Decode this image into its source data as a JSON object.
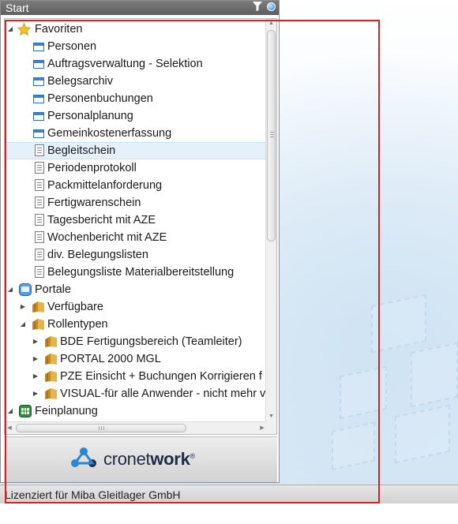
{
  "panel": {
    "title": "Start"
  },
  "tree": {
    "favoriten": {
      "label": "Favoriten",
      "items": [
        {
          "label": "Personen",
          "icon": "window-icon"
        },
        {
          "label": "Auftragsverwaltung - Selektion",
          "icon": "window-icon"
        },
        {
          "label": "Belegsarchiv",
          "icon": "window-icon"
        },
        {
          "label": "Personenbuchungen",
          "icon": "window-icon"
        },
        {
          "label": "Personalplanung",
          "icon": "window-icon"
        },
        {
          "label": "Gemeinkostenerfassung",
          "icon": "window-icon"
        },
        {
          "label": "Begleitschein",
          "icon": "document-icon"
        },
        {
          "label": "Periodenprotokoll",
          "icon": "document-icon"
        },
        {
          "label": "Packmittelanforderung",
          "icon": "document-icon"
        },
        {
          "label": "Fertigwarenschein",
          "icon": "document-icon"
        },
        {
          "label": "Tagesbericht mit AZE",
          "icon": "document-icon"
        },
        {
          "label": "Wochenbericht mit AZE",
          "icon": "document-icon"
        },
        {
          "label": "div. Belegungslisten",
          "icon": "document-icon"
        },
        {
          "label": "Belegungsliste Materialbereitstellung",
          "icon": "document-icon"
        }
      ]
    },
    "portale": {
      "label": "Portale",
      "verfuegbare": "Verfügbare",
      "rollentypen": "Rollentypen",
      "roles": [
        "BDE Fertigungsbereich (Teamleiter)",
        "PORTAL 2000 MGL",
        "PZE Einsicht + Buchungen Korrigieren f",
        "VISUAL-für alle Anwender - nicht mehr v"
      ]
    },
    "feinplanung": {
      "label": "Feinplanung"
    }
  },
  "logo": {
    "word_light": "cronet",
    "word_bold": "work",
    "mark": "®"
  },
  "status": {
    "text": "Lizenziert für Miba Gleitlager GmbH"
  },
  "colors": {
    "title_bar": "#6b6b6b",
    "selection": "#e4f1fa",
    "highlight_box": "#e02020",
    "logo_blue": "#2a86d6"
  }
}
